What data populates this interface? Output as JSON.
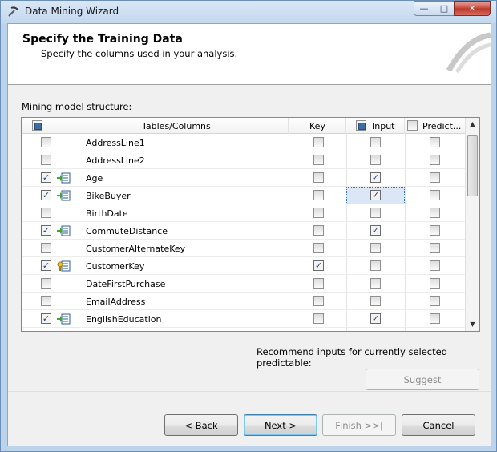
{
  "window": {
    "title": "Data Mining Wizard",
    "minimize": "—",
    "maximize": "□",
    "close": "✕"
  },
  "header": {
    "title": "Specify the Training Data",
    "subtitle": "Specify the columns used in your analysis."
  },
  "structure_label": "Mining model structure:",
  "grid": {
    "columns": [
      "Tables/Columns",
      "Key",
      "Input",
      "Predict..."
    ],
    "header_checks": {
      "all": "partial",
      "input": "partial",
      "predict": false
    },
    "rows": [
      {
        "name": "AddressLine1",
        "checked": false,
        "icon": "",
        "key": false,
        "input": false,
        "predict": false
      },
      {
        "name": "AddressLine2",
        "checked": false,
        "icon": "",
        "key": false,
        "input": false,
        "predict": false
      },
      {
        "name": "Age",
        "checked": true,
        "icon": "input-column-icon",
        "key": false,
        "input": true,
        "predict": false
      },
      {
        "name": "BikeBuyer",
        "checked": true,
        "icon": "input-column-icon",
        "key": false,
        "input": true,
        "predict": false
      },
      {
        "name": "BirthDate",
        "checked": false,
        "icon": "",
        "key": false,
        "input": false,
        "predict": false
      },
      {
        "name": "CommuteDistance",
        "checked": true,
        "icon": "input-column-icon",
        "key": false,
        "input": true,
        "predict": false
      },
      {
        "name": "CustomerAlternateKey",
        "checked": false,
        "icon": "",
        "key": false,
        "input": false,
        "predict": false
      },
      {
        "name": "CustomerKey",
        "checked": true,
        "icon": "key-column-icon",
        "key": true,
        "input": false,
        "predict": false
      },
      {
        "name": "DateFirstPurchase",
        "checked": false,
        "icon": "",
        "key": false,
        "input": false,
        "predict": false
      },
      {
        "name": "EmailAddress",
        "checked": false,
        "icon": "",
        "key": false,
        "input": false,
        "predict": false
      },
      {
        "name": "EnglishEducation",
        "checked": true,
        "icon": "input-column-icon",
        "key": false,
        "input": true,
        "predict": false
      }
    ]
  },
  "recommend_label": "Recommend inputs for currently selected predictable:",
  "buttons": {
    "suggest": "Suggest",
    "back": "< Back",
    "next": "Next >",
    "finish": "Finish >>|",
    "cancel": "Cancel"
  },
  "colors": {
    "checkmark": "#1f3a78",
    "selection": "#dbe7f7",
    "title_gradient": "#c4d8ee"
  }
}
